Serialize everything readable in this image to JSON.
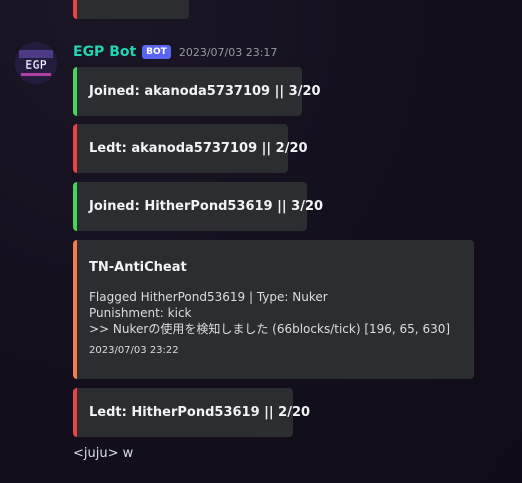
{
  "author": {
    "name": "EGP Bot",
    "badge": "BOT",
    "timestamp": "2023/07/03 23:17",
    "avatar_text": "EGP"
  },
  "embeds": [
    {
      "text": "Joined: akanoda5737109 || 3/20",
      "color": "#43d65a"
    },
    {
      "text": "Ledt: akanoda5737109 || 2/20",
      "color": "#ed4245"
    },
    {
      "text": "Joined: HitherPond53619 || 3/20",
      "color": "#43d65a"
    }
  ],
  "anticheat": {
    "title": "TN-AntiCheat",
    "line1": "Flagged HitherPond53619 | Type: Nuker",
    "line2": "Punishment: kick",
    "line3": ">> Nukerの使用を検知しました (66blocks/tick) [196, 65, 630]",
    "footer": "2023/07/03 23:22",
    "color": "#f47b4a"
  },
  "last_embed": {
    "text": "Ledt: HitherPond53619 || 2/20",
    "color": "#ed4245"
  },
  "chat_message": "<juju> w"
}
